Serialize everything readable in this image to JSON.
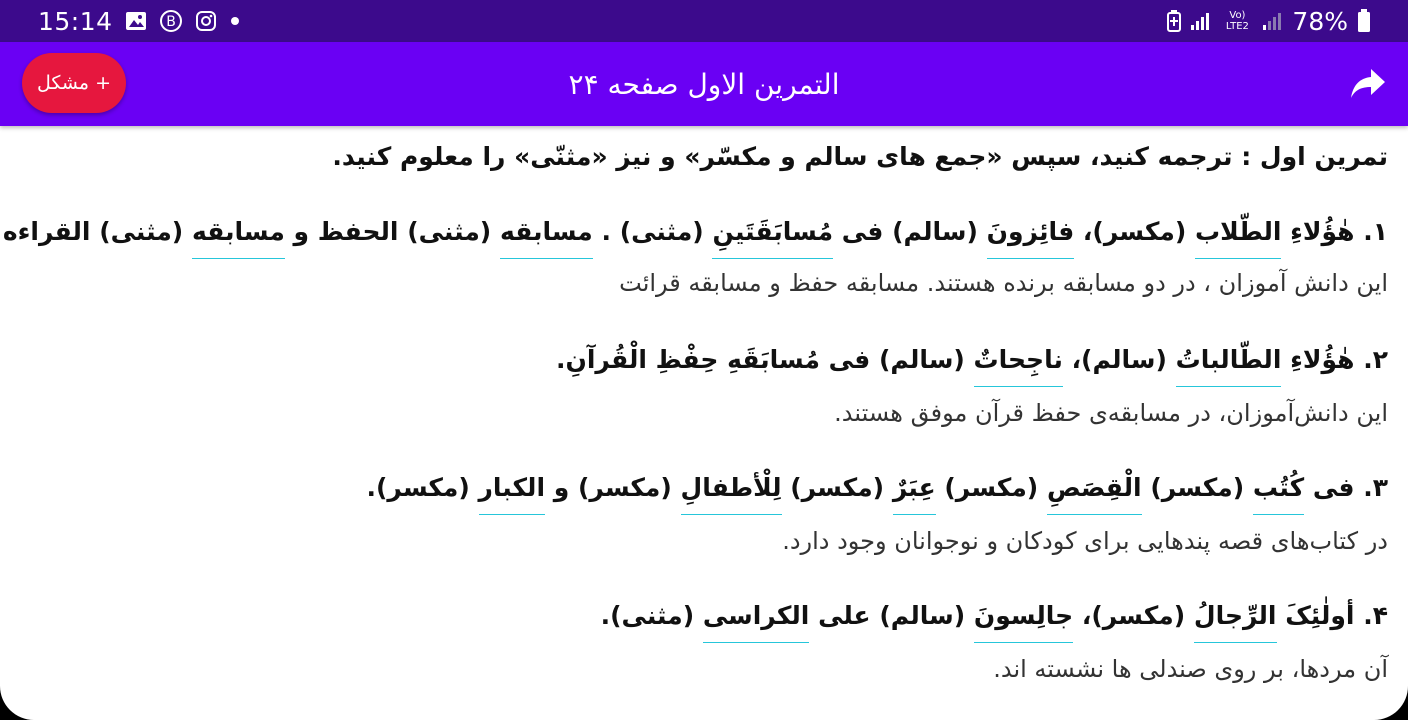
{
  "status_bar": {
    "time": "15:14",
    "battery": "78%",
    "network": "Vo) LTE2",
    "icons": [
      "image-icon",
      "b-circle-icon",
      "instagram-icon",
      "dot-icon",
      "battery-saver-icon",
      "signal-icon",
      "signal-icon-2",
      "battery-icon"
    ]
  },
  "app_bar": {
    "title": "التمرین الاول صفحه ۲۴",
    "problem_button_label": "+ مشکل",
    "share_icon": "share-icon",
    "color": "#6a00f4",
    "button_color": "#e6173e"
  },
  "content": {
    "intro": "تمرین اول : ترجمه کنید، سپس «جمع های سالم و مکسّر» و نیز «مثنّی» را معلوم کنید.",
    "exercises": [
      {
        "num": "۱.",
        "parts": [
          "هٰؤُلاءِ ",
          "الطّلاب",
          " (مکسر)، ",
          "فائِزونَ",
          " (سالم) فی ",
          "مُسابَقَتَینِ",
          " (مثنی) . ",
          "مسابقه",
          " (مثنی) الحفظ و ",
          "مسابقه",
          " (مثنی) القراءه"
        ],
        "translation": "این دانش آموزان ، در دو مسابقه برنده هستند. مسابقه حفظ و مسابقه قرائت"
      },
      {
        "num": "۲.",
        "parts": [
          "هٰؤُلاءِ ",
          "الطّالباتُ",
          " (سالم)، ",
          "ناجِحاتٌ",
          " (سالم) فی مُسابَقَهِ حِفْظِ الْقُرآنِ."
        ],
        "translation": "این دانش‌آموزان، در مسابقه‌ی حفظ قرآن موفق هستند."
      },
      {
        "num": "۳.",
        "parts": [
          "فی ",
          "کُتُب",
          " (مکسر) ",
          "الْقِصَصِ",
          " (مکسر) ",
          "عِبَرٌ",
          " (مکسر) ",
          "لِلْأطفالِ",
          " (مکسر) و ",
          "الکبار",
          " (مکسر)."
        ],
        "translation": "در کتاب‌های قصه پندهایی برای کودکان و نوجوانان وجود دارد."
      },
      {
        "num": "۴.",
        "parts": [
          "أولٰئِکَ ",
          "الرِّجالُ",
          " (مکسر)، ",
          "جالِسونَ",
          " (سالم) علی ",
          "الکراسی",
          " (مثنی)."
        ],
        "translation": "آن مردها، بر روی صندلی ها نشسته اند."
      }
    ],
    "underline_color": "#26c6da"
  }
}
